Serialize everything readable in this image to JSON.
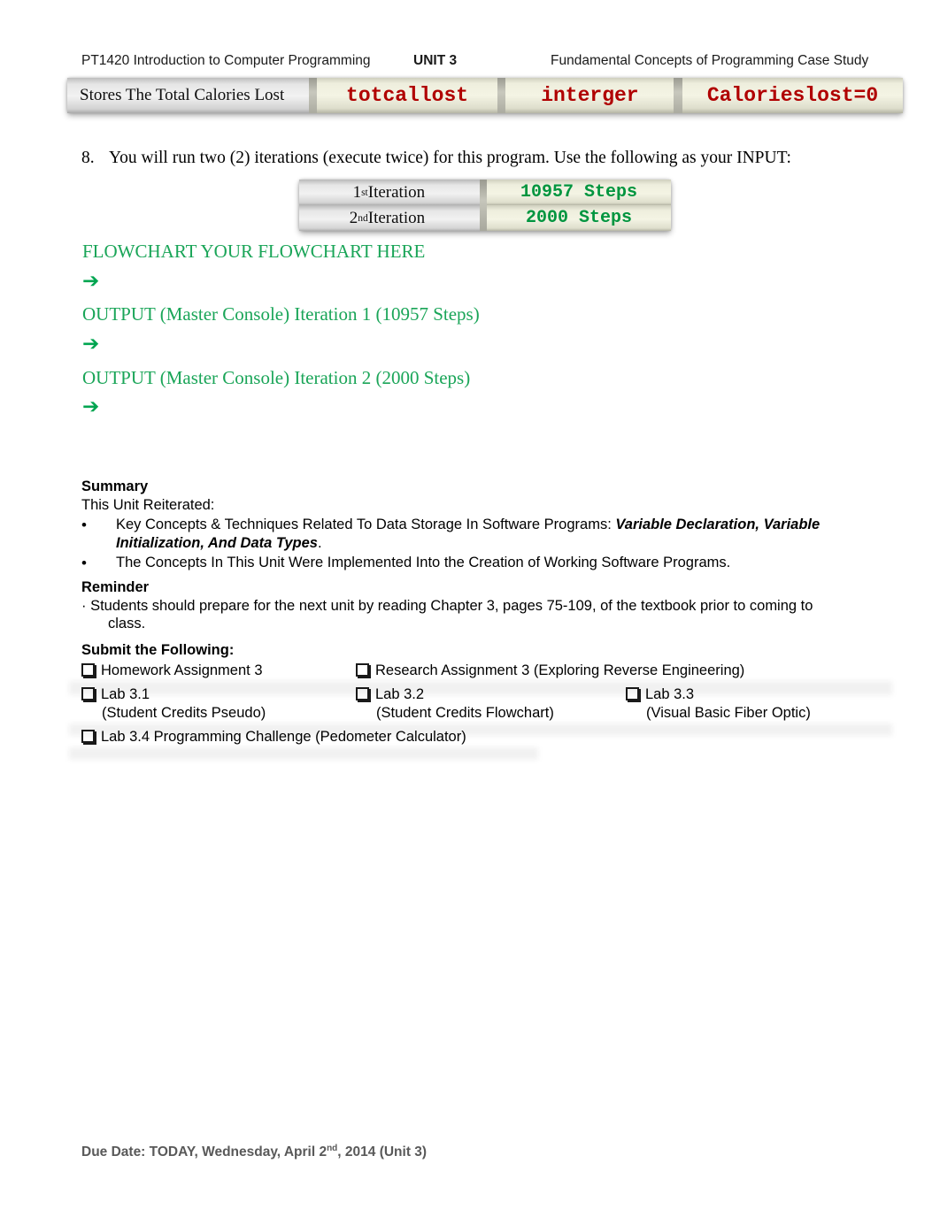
{
  "header": {
    "course": "PT1420 Introduction to Computer Programming",
    "unit": "UNIT 3",
    "title": "Fundamental Concepts of Programming Case Study"
  },
  "variable_table": {
    "description": "Stores The Total Calories Lost",
    "name": "totcallost",
    "type": "interger",
    "initialization": "Calorieslost=0"
  },
  "item8": {
    "number": "8.",
    "text": "You will run two (2) iterations (execute twice) for this program.  Use the following as your INPUT:"
  },
  "iterations": {
    "rows": [
      {
        "ordinal": "1",
        "suffix": "st",
        "label": "Iteration",
        "value": "10957 Steps"
      },
      {
        "ordinal": "2",
        "suffix": "nd",
        "label": "Iteration",
        "value": "2000 Steps"
      }
    ]
  },
  "green_sections": {
    "flowchart_heading": "FLOWCHART YOUR FLOWCHART HERE",
    "output1_heading": "OUTPUT (Master Console) Iteration 1 (10957 Steps)",
    "output2_heading": "OUTPUT (Master Console) Iteration 2 (2000 Steps)",
    "arrow_glyph": "➔"
  },
  "summary": {
    "title": "Summary",
    "subtitle": "This Unit Reiterated:",
    "bullet_glyph": "•",
    "bullets": [
      {
        "lead": "Key Concepts & Techniques Related To Data Storage In Software Programs: ",
        "emphasis": "Variable Declaration, Variable Initialization, And Data Types",
        "tail": "."
      },
      {
        "lead": "The Concepts In This Unit Were Implemented Into the Creation of Working Software Programs.",
        "emphasis": "",
        "tail": ""
      }
    ]
  },
  "reminder": {
    "title": "Reminder",
    "line1": "· Students should prepare for the next unit by reading Chapter 3, pages 75-109, of the textbook prior to coming to",
    "line2": "class."
  },
  "submit": {
    "title": "Submit the Following:",
    "items": [
      {
        "label": "Homework Assignment 3",
        "sub": ""
      },
      {
        "label": "Research Assignment 3 (Exploring Reverse Engineering)",
        "sub": ""
      },
      {
        "label": "Lab 3.1",
        "sub": "(Student Credits Pseudo)"
      },
      {
        "label": "Lab 3.2",
        "sub": "(Student Credits Flowchart)"
      },
      {
        "label": "Lab 3.3",
        "sub": "(Visual Basic Fiber Optic)"
      },
      {
        "label": "Lab 3.4 Programming Challenge (Pedometer Calculator)",
        "sub": ""
      }
    ]
  },
  "footer": {
    "due_date_lead": "Due Date: TODAY, Wednesday, April 2",
    "due_date_sup": "nd",
    "due_date_tail": ", 2014 (Unit 3)"
  },
  "colors": {
    "code_red": "#b00000",
    "steps_green": "#00953f",
    "heading_green": "#1aa558",
    "footer_gray": "#595959",
    "cell_cream": "#f4f4e4",
    "cell_gray": "#f1f1f1"
  }
}
